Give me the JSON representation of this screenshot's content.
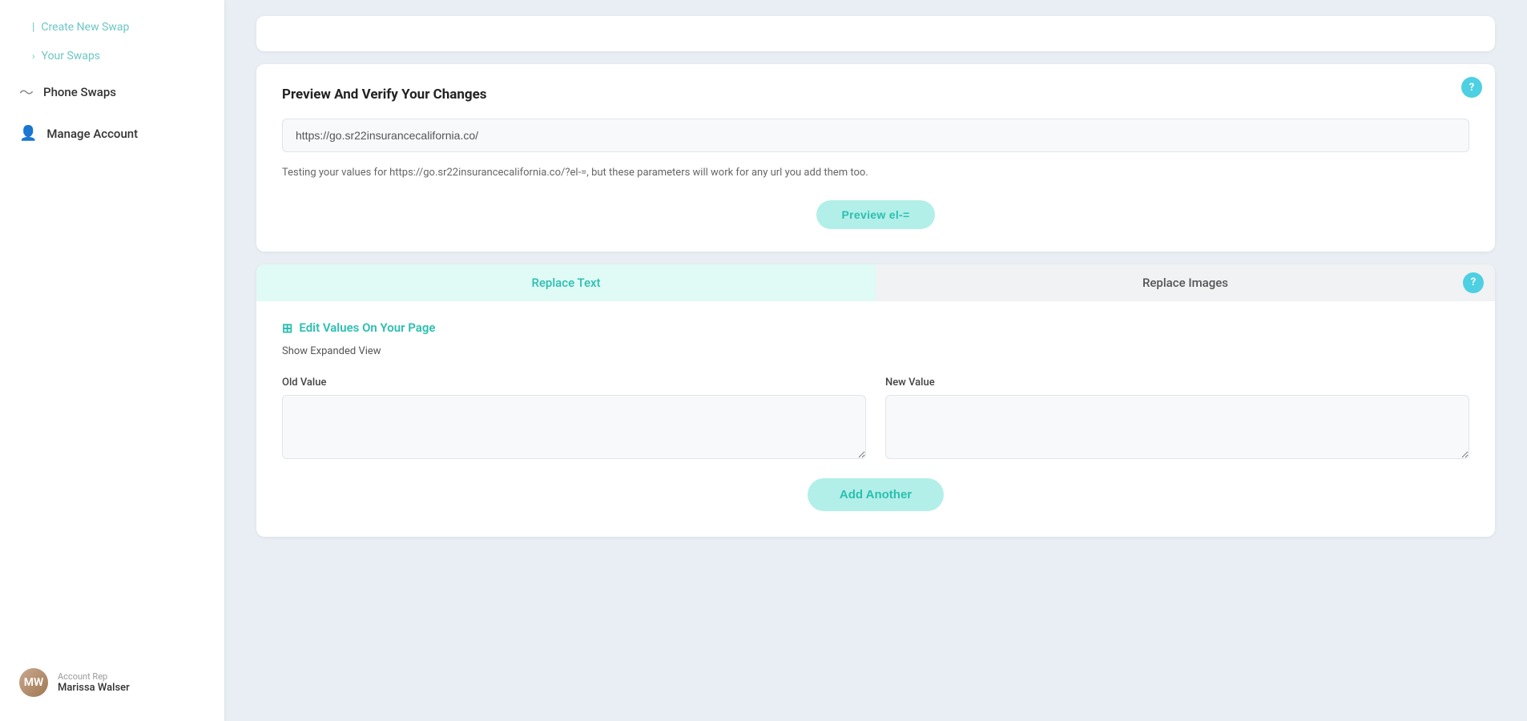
{
  "sidebar": {
    "create_new_swap_label": "Create New Swap",
    "your_swaps_label": "Your Swaps",
    "phone_swaps_label": "Phone Swaps",
    "manage_account_label": "Manage Account",
    "account_rep_label": "Account Rep",
    "account_name": "Marissa Walser"
  },
  "preview_section": {
    "title": "Preview And Verify Your Changes",
    "url_value": "https://go.sr22insurancecalifornia.co/",
    "note_part1": "Testing your values for https://go.sr22insurancecalifornia.co/?el-=, but these parameters will work for any url you add them too.",
    "preview_button_label": "Preview el-=",
    "help_icon": "?"
  },
  "replace_section": {
    "tab_replace_text_label": "Replace Text",
    "tab_replace_images_label": "Replace Images",
    "help_icon": "?",
    "edit_values_title": "Edit Values On Your Page",
    "show_expanded_label": "Show Expanded View",
    "old_value_label": "Old Value",
    "new_value_label": "New Value",
    "old_value_placeholder": "",
    "new_value_placeholder": "",
    "add_another_label": "Add Another"
  }
}
